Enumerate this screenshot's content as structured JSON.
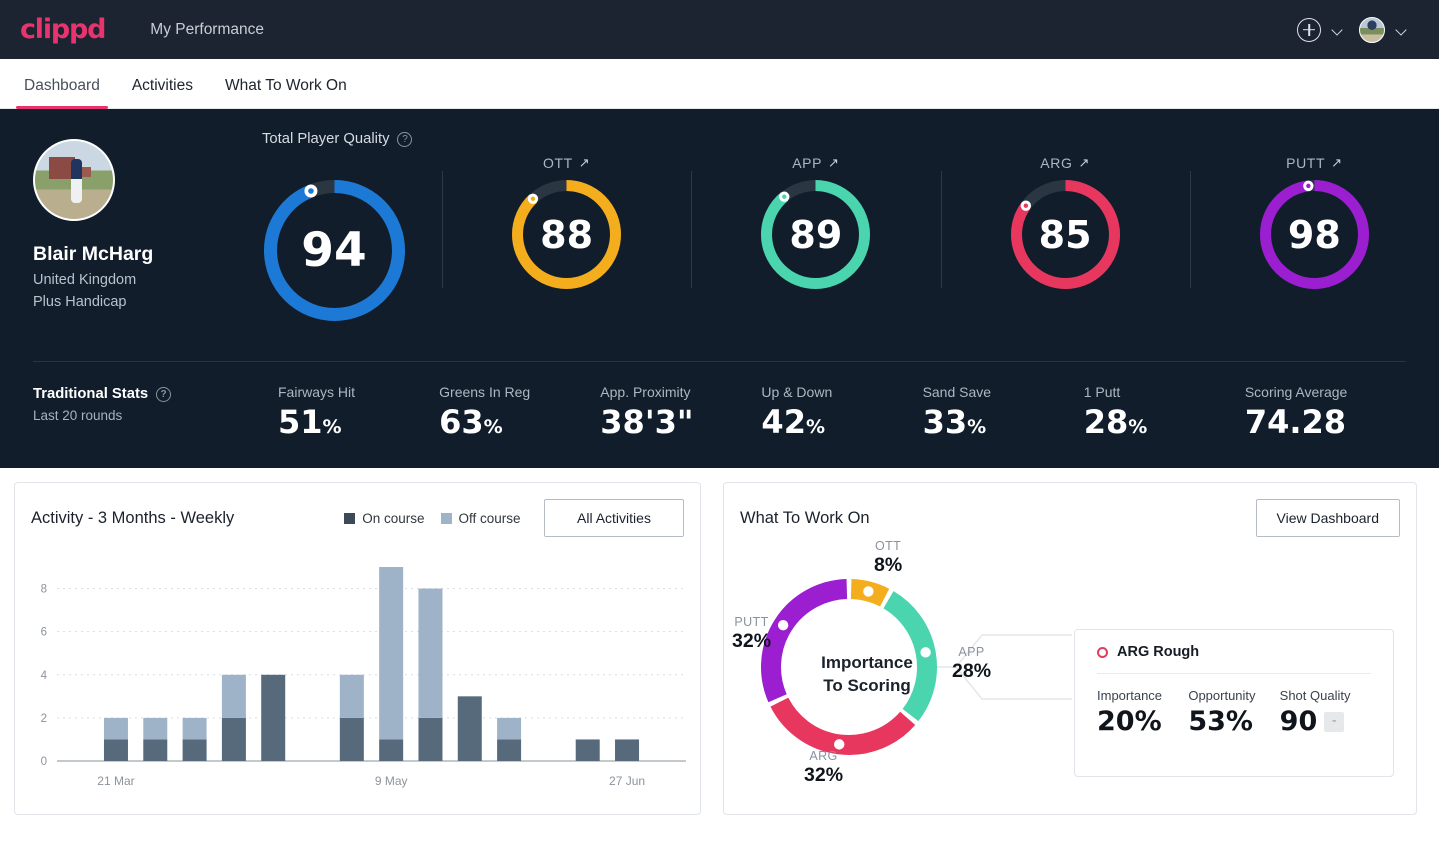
{
  "header": {
    "logo": "clippd",
    "app_title": "My Performance",
    "add_icon": "plus-circle-icon",
    "add_chevron": "chevron-down-icon",
    "profile_chevron": "chevron-down-icon"
  },
  "tabs": [
    {
      "label": "Dashboard",
      "active": true
    },
    {
      "label": "Activities",
      "active": false
    },
    {
      "label": "What To Work On",
      "active": false
    }
  ],
  "profile": {
    "name": "Blair McHarg",
    "country": "United Kingdom",
    "handicap": "Plus Handicap"
  },
  "quality": {
    "section_label": "Total Player Quality",
    "help_icon": "question-mark-icon",
    "gauges": [
      {
        "key": "tpq",
        "title": "",
        "value": "94",
        "percent": 94,
        "color": "#1c7ad6",
        "big": true
      },
      {
        "key": "ott",
        "title": "OTT",
        "value": "88",
        "percent": 88,
        "color": "#f4ad1d",
        "trend": "↗"
      },
      {
        "key": "app",
        "title": "APP",
        "value": "89",
        "percent": 89,
        "color": "#4ad5ae",
        "trend": "↗"
      },
      {
        "key": "arg",
        "title": "ARG",
        "value": "85",
        "percent": 85,
        "color": "#e8375f",
        "trend": "↗"
      },
      {
        "key": "putt",
        "title": "PUTT",
        "value": "98",
        "percent": 98,
        "color": "#9b1ed1",
        "trend": "↗"
      }
    ]
  },
  "traditional": {
    "title": "Traditional Stats",
    "help_icon": "question-mark-icon",
    "subtitle": "Last 20 rounds",
    "stats": [
      {
        "name": "Fairways Hit",
        "value": "51",
        "unit": "%"
      },
      {
        "name": "Greens In Reg",
        "value": "63",
        "unit": "%"
      },
      {
        "name": "App. Proximity",
        "value": "38'3\"",
        "unit": ""
      },
      {
        "name": "Up & Down",
        "value": "42",
        "unit": "%"
      },
      {
        "name": "Sand Save",
        "value": "33",
        "unit": "%"
      },
      {
        "name": "1 Putt",
        "value": "28",
        "unit": "%"
      },
      {
        "name": "Scoring Average",
        "value": "74.28",
        "unit": ""
      }
    ]
  },
  "activity": {
    "title": "Activity - 3 Months - Weekly",
    "legend": [
      {
        "label": "On course",
        "color": "#3c4a57"
      },
      {
        "label": "Off course",
        "color": "#9fb3c8"
      }
    ],
    "button": "All Activities"
  },
  "what_to_work_on": {
    "title": "What To Work On",
    "button": "View Dashboard",
    "center_line1": "Importance",
    "center_line2": "To Scoring",
    "segments": [
      {
        "label": "OTT",
        "value": "8%",
        "percent": 8,
        "color": "#f4ad1d"
      },
      {
        "label": "APP",
        "value": "28%",
        "percent": 28,
        "color": "#4ad5ae"
      },
      {
        "label": "ARG",
        "value": "32%",
        "percent": 32,
        "color": "#e8375f"
      },
      {
        "label": "PUTT",
        "value": "32%",
        "percent": 32,
        "color": "#9b1ed1"
      }
    ],
    "detail": {
      "marker_icon": "circle-outline-icon",
      "name": "ARG Rough",
      "stats": [
        {
          "label": "Importance",
          "value": "20%"
        },
        {
          "label": "Opportunity",
          "value": "53%"
        },
        {
          "label": "Shot Quality",
          "value": "90",
          "badge": "-"
        }
      ]
    }
  },
  "chart_data": {
    "type": "bar",
    "title": "Activity - 3 Months - Weekly",
    "stacked": true,
    "xlabel": "",
    "ylabel": "",
    "ylim": [
      0,
      9
    ],
    "yticks": [
      0,
      2,
      4,
      6,
      8
    ],
    "grid": true,
    "legend_position": "top-right",
    "categories": [
      "w1",
      "w2",
      "w3",
      "w4",
      "w5",
      "w6",
      "w7",
      "w8",
      "w9",
      "w10",
      "w11",
      "w12",
      "w13",
      "w14",
      "w15",
      "w16"
    ],
    "tick_labels": [
      {
        "index": 1,
        "label": "21 Mar"
      },
      {
        "index": 8,
        "label": "9 May"
      },
      {
        "index": 14,
        "label": "27 Jun"
      }
    ],
    "series": [
      {
        "name": "On course",
        "color": "#566a7c",
        "values": [
          0,
          1,
          1,
          1,
          2,
          4,
          0,
          2,
          1,
          2,
          3,
          1,
          0,
          1,
          1,
          0
        ]
      },
      {
        "name": "Off course",
        "color": "#9fb3c8",
        "values": [
          0,
          1,
          1,
          1,
          2,
          0,
          0,
          2,
          8,
          6,
          0,
          1,
          0,
          0,
          0,
          0
        ]
      }
    ],
    "totals": [
      0,
      2,
      2,
      2,
      4,
      4,
      0,
      4,
      9,
      8,
      3,
      2,
      0,
      1,
      1,
      0
    ]
  }
}
